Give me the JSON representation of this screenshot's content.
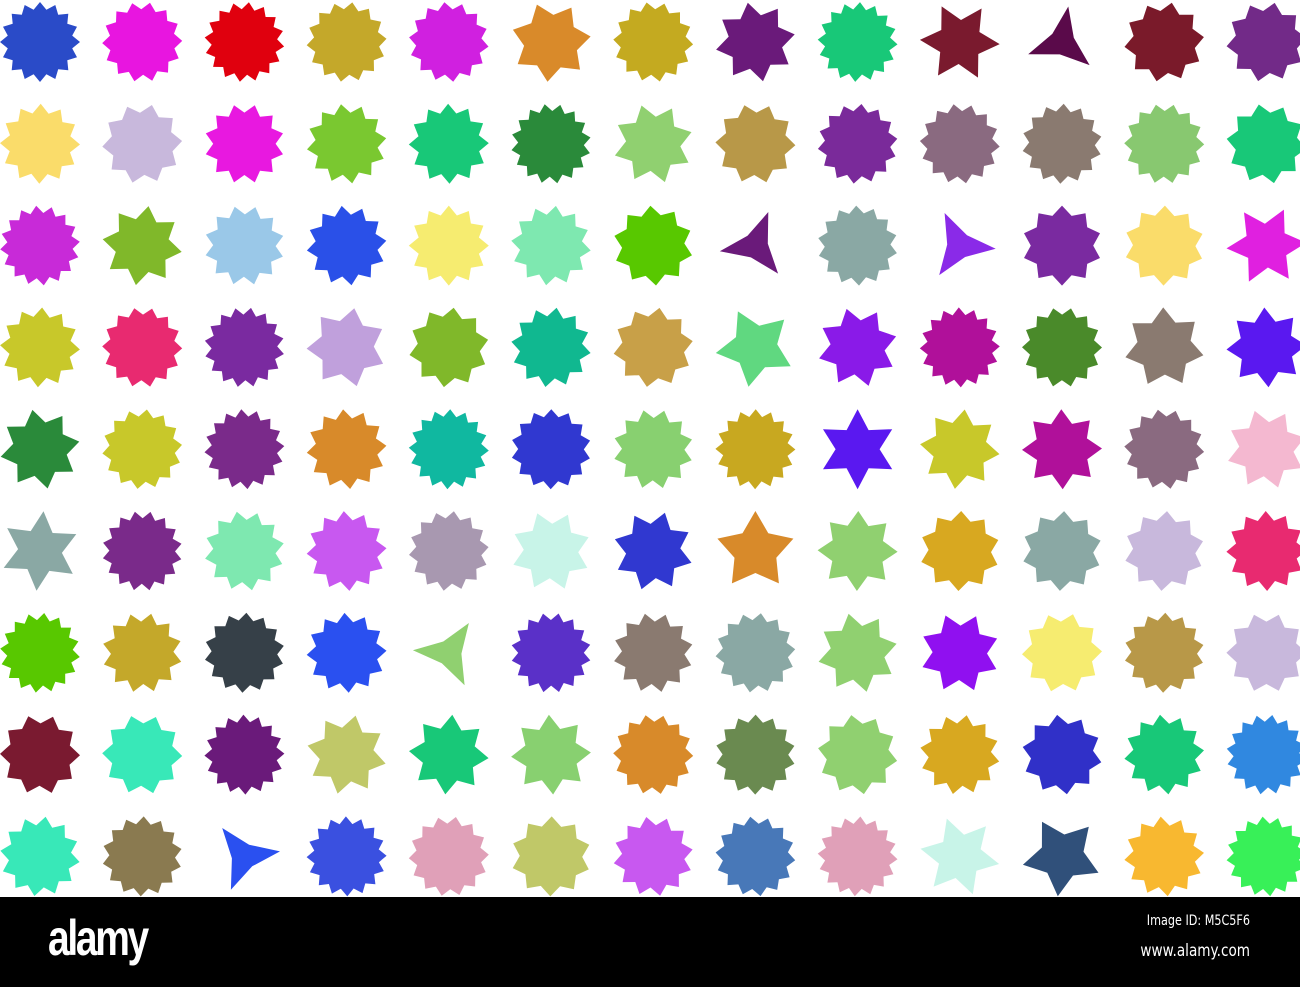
{
  "grid": {
    "rows": [
      {
        "colors": [
          "#2a4bc8",
          "#e815e0",
          "#e0000e",
          "#c4a82a",
          "#d020e0",
          "#d98a2a",
          "#c4aa20",
          "#6a1a7a",
          "#18c878",
          "#7a1a2e",
          "#5a0a4a",
          "#7a1a2a",
          "#722a88"
        ],
        "points": [
          16,
          14,
          16,
          14,
          14,
          7,
          14,
          8,
          16,
          6,
          3,
          10,
          10
        ]
      },
      {
        "colors": [
          "#fadc6a",
          "#c8b8dc",
          "#e818e0",
          "#7ac830",
          "#18c878",
          "#2a8a3a",
          "#90d070",
          "#b89848",
          "#7a2a9a",
          "#8a6a80",
          "#8a7a70",
          "#88c870",
          "#18c878"
        ],
        "points": [
          12,
          10,
          12,
          12,
          12,
          16,
          8,
          10,
          14,
          14,
          14,
          14,
          10
        ]
      },
      {
        "colors": [
          "#c82ad8",
          "#80b82a",
          "#9ac8e8",
          "#2a50e8",
          "#f6ec70",
          "#7ee8b0",
          "#58c800",
          "#6a1a7a",
          "#8aa8a4",
          "#8a2ae8",
          "#7a2aa0",
          "#fadc6a",
          "#e020e0"
        ],
        "points": [
          16,
          8,
          12,
          12,
          12,
          12,
          10,
          3,
          14,
          3,
          10,
          10,
          6
        ]
      },
      {
        "colors": [
          "#c8c82a",
          "#e82a70",
          "#7a2aa0",
          "#c0a0dc",
          "#80b82a",
          "#10b890",
          "#c8a048",
          "#60d880",
          "#8a1ae8",
          "#b0109a",
          "#4a8a2a",
          "#8a7a70",
          "#5a18f0"
        ],
        "points": [
          12,
          14,
          16,
          7,
          10,
          12,
          10,
          5,
          8,
          16,
          14,
          7,
          8
        ]
      },
      {
        "colors": [
          "#2a8a3a",
          "#c8c82a",
          "#7a2a8a",
          "#d88a2a",
          "#10b8a0",
          "#3038d0",
          "#88d070",
          "#c8a820",
          "#5a18f0",
          "#c8c82a",
          "#b0109a",
          "#8a6a80",
          "#f4b8d0"
        ],
        "points": [
          8,
          14,
          16,
          12,
          16,
          14,
          12,
          16,
          6,
          8,
          8,
          14,
          8
        ]
      },
      {
        "colors": [
          "#8aa8a4",
          "#7a2a8a",
          "#7ee8b0",
          "#c858f0",
          "#a898b0",
          "#c8f4e8",
          "#3038d0",
          "#d88a2a",
          "#90d070",
          "#d8a820",
          "#8aa8a4",
          "#c8b8dc",
          "#e82a70"
        ],
        "points": [
          6,
          16,
          12,
          12,
          14,
          8,
          8,
          5,
          8,
          10,
          10,
          10,
          12
        ]
      },
      {
        "colors": [
          "#58c800",
          "#c4a82a",
          "#364048",
          "#2a50f0",
          "#90d070",
          "#5a30c8",
          "#8a7a70",
          "#8aa8a4",
          "#90d070",
          "#9010f0",
          "#f6ec70",
          "#b89848",
          "#c8b8dc"
        ],
        "points": [
          16,
          12,
          14,
          12,
          3,
          16,
          12,
          14,
          8,
          8,
          10,
          14,
          10
        ]
      },
      {
        "colors": [
          "#7a1a30",
          "#38e8b8",
          "#6a1a7a",
          "#c0c868",
          "#18c878",
          "#88d070",
          "#d88a2a",
          "#6a8a50",
          "#90d070",
          "#d8a820",
          "#3030c8",
          "#18c878",
          "#3088e0"
        ],
        "points": [
          10,
          10,
          16,
          8,
          8,
          8,
          14,
          14,
          10,
          12,
          10,
          12,
          16
        ]
      },
      {
        "colors": [
          "#38e8b8",
          "#8a7a50",
          "#2a50f0",
          "#3a50e0",
          "#e0a0b8",
          "#c0c868",
          "#c858f0",
          "#4878b8",
          "#e0a0b8",
          "#c8f4e8",
          "#30507a",
          "#f8b830",
          "#38f058"
        ],
        "points": [
          12,
          14,
          3,
          16,
          14,
          10,
          12,
          14,
          16,
          6,
          5,
          12,
          16
        ]
      }
    ]
  },
  "footer": {
    "logo": "alamy",
    "image_id": "Image ID: M5C5F6",
    "website": "www.alamy.com"
  }
}
